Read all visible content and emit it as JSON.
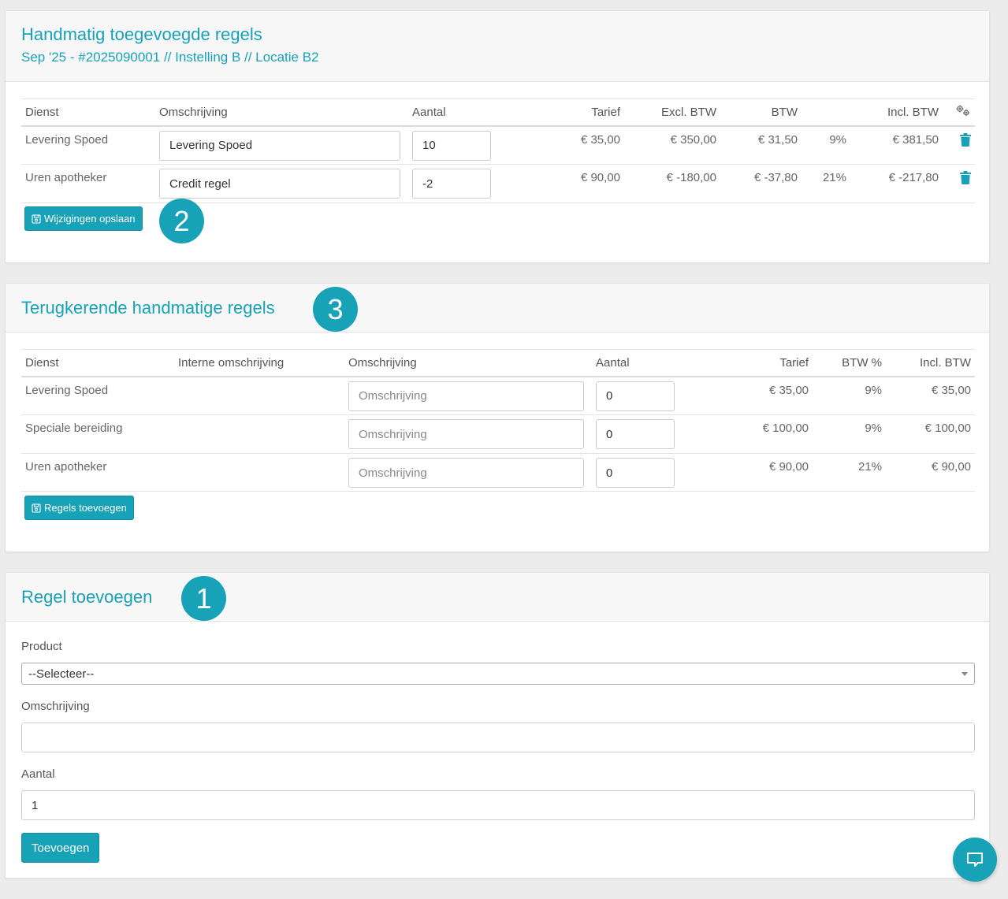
{
  "card1": {
    "title": "Handmatig toegevoegde regels",
    "subtitle": "Sep '25 - #2025090001 // Instelling B // Locatie B2",
    "columns": [
      "Dienst",
      "Omschrijving",
      "Aantal",
      "Tarief",
      "Excl. BTW",
      "BTW",
      "",
      "Incl. BTW"
    ],
    "rows": [
      {
        "dienst": "Levering Spoed",
        "omschrijving": "Levering Spoed",
        "aantal": "10",
        "tarief": "€ 35,00",
        "excl": "€ 350,00",
        "btw": "€ 31,50",
        "pct": "9%",
        "incl": "€ 381,50"
      },
      {
        "dienst": "Uren apotheker",
        "omschrijving": "Credit regel",
        "aantal": "-2",
        "tarief": "€ 90,00",
        "excl": "€ -180,00",
        "btw": "€ -37,80",
        "pct": "21%",
        "incl": "€ -217,80"
      }
    ],
    "save_label": "Wijzigingen opslaan",
    "badge": "2"
  },
  "card2": {
    "title": "Terugkerende handmatige regels",
    "columns": [
      "Dienst",
      "Interne omschrijving",
      "Omschrijving",
      "Aantal",
      "Tarief",
      "BTW %",
      "Incl. BTW"
    ],
    "placeholder": "Omschrijving",
    "rows": [
      {
        "dienst": "Levering Spoed",
        "intern": "",
        "aantal": "0",
        "tarief": "€ 35,00",
        "pct": "9%",
        "incl": "€ 35,00"
      },
      {
        "dienst": "Speciale bereiding",
        "intern": "",
        "aantal": "0",
        "tarief": "€ 100,00",
        "pct": "9%",
        "incl": "€ 100,00"
      },
      {
        "dienst": "Uren apotheker",
        "intern": "",
        "aantal": "0",
        "tarief": "€ 90,00",
        "pct": "21%",
        "incl": "€ 90,00"
      }
    ],
    "add_label": "Regels toevoegen",
    "badge": "3"
  },
  "card3": {
    "title": "Regel toevoegen",
    "badge": "1",
    "product_label": "Product",
    "product_value": "--Selecteer--",
    "omschrijving_label": "Omschrijving",
    "omschrijving_value": "",
    "aantal_label": "Aantal",
    "aantal_value": "1",
    "submit_label": "Toevoegen"
  },
  "colors": {
    "accent": "#17a2b8",
    "background": "#ececec"
  },
  "icons": [
    "save-icon",
    "trash-icon",
    "gears-icon",
    "chat-icon",
    "chevron-down-icon"
  ]
}
